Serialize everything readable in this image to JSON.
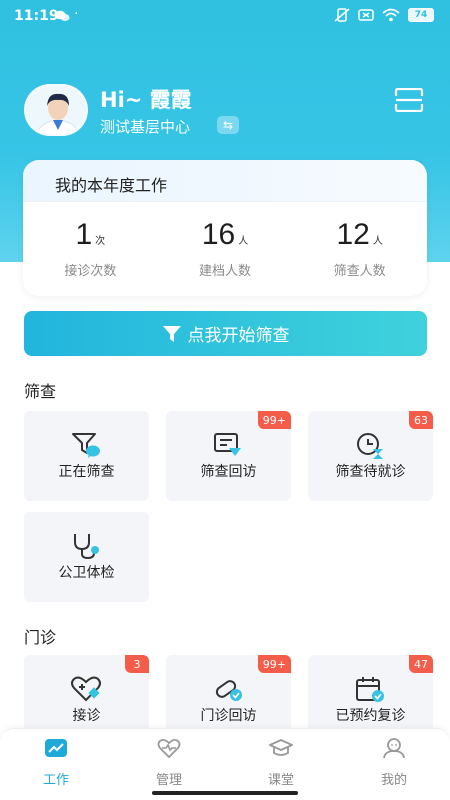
{
  "status_bar": {
    "time": "11:19",
    "dot": "·",
    "battery": "74"
  },
  "profile": {
    "greeting": "Hi~ 霞霞",
    "center_name": "测试基层中心",
    "switch_symbol": "⇆"
  },
  "annual_work": {
    "title": "我的本年度工作",
    "stats": [
      {
        "value": "1",
        "unit": "次",
        "label": "接诊次数"
      },
      {
        "value": "16",
        "unit": "人",
        "label": "建档人数"
      },
      {
        "value": "12",
        "unit": "人",
        "label": "筛查人数"
      }
    ]
  },
  "start_button": {
    "label": "点我开始筛查",
    "icon": "funnel-icon"
  },
  "screening": {
    "title": "筛查",
    "tiles": [
      {
        "label": "正在筛查",
        "icon": "funnel-chat-icon",
        "badge": ""
      },
      {
        "label": "筛查回访",
        "icon": "message-followup-icon",
        "badge": "99+"
      },
      {
        "label": "筛查待就诊",
        "icon": "clock-pending-icon",
        "badge": "63"
      },
      {
        "label": "公卫体检",
        "icon": "stethoscope-icon",
        "badge": ""
      }
    ]
  },
  "clinic": {
    "title": "门诊",
    "tiles": [
      {
        "label": "接诊",
        "icon": "heart-plus-icon",
        "badge": "3"
      },
      {
        "label": "门诊回访",
        "icon": "pill-followup-icon",
        "badge": "99+"
      },
      {
        "label": "已预约复诊",
        "icon": "calendar-check-icon",
        "badge": "47"
      }
    ]
  },
  "bottom_nav": [
    {
      "label": "工作",
      "icon": "chart-icon",
      "active": true
    },
    {
      "label": "管理",
      "icon": "heart-pulse-icon",
      "active": false
    },
    {
      "label": "课堂",
      "icon": "graduation-cap-icon",
      "active": false
    },
    {
      "label": "我的",
      "icon": "user-icon",
      "active": false
    }
  ],
  "colors": {
    "primary": "#2fc0e0",
    "badge": "#f45d4a",
    "active_nav": "#1fa9d6"
  }
}
